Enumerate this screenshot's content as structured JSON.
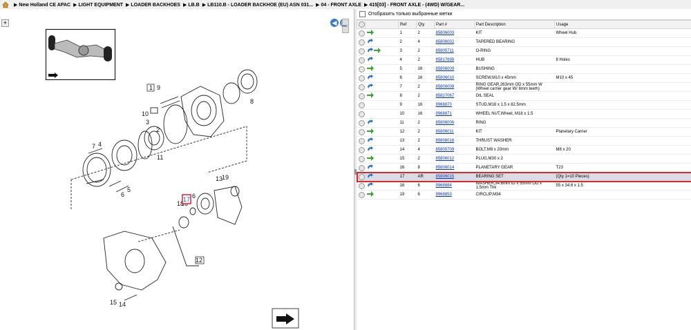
{
  "breadcrumb": {
    "items": [
      "New Holland CE APAC",
      "LIGHT EQUIPMENT",
      "LOADER BACKHOES",
      "LB.B",
      "LB110.B - LOADER BACKHOE (EU) ASN 031...",
      "04 - FRONT AXLE",
      "415[03] - FRONT AXLE - (4WD) W/GEAR..."
    ]
  },
  "filter": {
    "label": "Отобразить только выбранные метки"
  },
  "table": {
    "headers": [
      "Ref",
      "Qty",
      "Part #",
      "Part Description",
      "Usage"
    ],
    "rows": [
      {
        "ref": "1",
        "qty": "2",
        "part": "85806003",
        "desc": "KIT",
        "usage": "Wheel Hub",
        "icons": [
          "green"
        ]
      },
      {
        "ref": "2",
        "qty": "4",
        "part": "85806002",
        "desc": "TAPERED BEARING",
        "usage": "",
        "icons": [
          "blue"
        ]
      },
      {
        "ref": "3",
        "qty": "2",
        "part": "85805711",
        "desc": "O-RING",
        "usage": "",
        "icons": [
          "blue",
          "green"
        ]
      },
      {
        "ref": "4",
        "qty": "2",
        "part": "85817698",
        "desc": "HUB",
        "usage": "8 Holes",
        "icons": [
          "blue"
        ]
      },
      {
        "ref": "5",
        "qty": "16",
        "part": "85806009",
        "desc": "BUSHING",
        "usage": "",
        "icons": [
          "green"
        ]
      },
      {
        "ref": "6",
        "qty": "16",
        "part": "85806010",
        "desc": "SCREW,M10 x 45mm",
        "usage": "M10 x 45",
        "icons": [
          "blue"
        ]
      },
      {
        "ref": "7",
        "qty": "2",
        "part": "85806008",
        "desc": "RING GEAR,263mm OD x 55mm W (Wheel carrier gear W/ 8mm teeth)",
        "usage": "",
        "icons": [
          "blue"
        ]
      },
      {
        "ref": "8",
        "qty": "2",
        "part": "85827067",
        "desc": "OIL SEAL",
        "usage": "",
        "icons": [
          "green"
        ]
      },
      {
        "ref": "9",
        "qty": "16",
        "part": "9968870",
        "desc": "STUD,M18 x 1.5 x 82.5mm",
        "usage": "",
        "icons": []
      },
      {
        "ref": "10",
        "qty": "16",
        "part": "9968871",
        "desc": "WHEEL NUT,Wheel, M18 x 1.5",
        "usage": "",
        "icons": []
      },
      {
        "ref": "11",
        "qty": "2",
        "part": "85806006",
        "desc": "RING",
        "usage": "",
        "icons": [
          "blue"
        ]
      },
      {
        "ref": "12",
        "qty": "2",
        "part": "85806011",
        "desc": "KIT",
        "usage": "Planetary Carrier",
        "icons": [
          "green"
        ]
      },
      {
        "ref": "13",
        "qty": "2",
        "part": "85806016",
        "desc": "THRUST WASHER",
        "usage": "",
        "icons": [
          "blue"
        ]
      },
      {
        "ref": "14",
        "qty": "4",
        "part": "85805709",
        "desc": "BOLT,M8 x 20mm",
        "usage": "M8 x 20",
        "icons": [
          "blue"
        ]
      },
      {
        "ref": "15",
        "qty": "2",
        "part": "85806012",
        "desc": "PLUG,M30 x 2",
        "usage": "",
        "icons": [
          "green"
        ]
      },
      {
        "ref": "16",
        "qty": "8",
        "part": "85806014",
        "desc": "PLANETARY GEAR",
        "usage": "T23",
        "icons": [
          "blue"
        ]
      },
      {
        "ref": "17",
        "qty": "AR",
        "part": "85806015",
        "desc": "BEARING SET",
        "usage": "(Qty 1=10 Pieces)",
        "icons": [
          "blue"
        ],
        "selected": true
      },
      {
        "ref": "18",
        "qty": "6",
        "part": "9968884",
        "desc": "WASHER,34.6mm ID x 55mm OD x 1.5mm Thk",
        "usage": "55 x 34.6 x 1.5",
        "icons": [
          "blue"
        ]
      },
      {
        "ref": "19",
        "qty": "6",
        "part": "9968853",
        "desc": "CIRCLIP,M34",
        "usage": "",
        "icons": [
          "green"
        ]
      }
    ]
  },
  "diagram": {
    "callouts": [
      "1",
      "9",
      "10",
      "3",
      "2",
      "8",
      "7",
      "4",
      "11",
      "5",
      "6",
      "19",
      "13",
      "6",
      "18",
      "16",
      "12",
      "15",
      "14"
    ],
    "highlight": "17"
  },
  "colors": {
    "highlight": "#e0262b",
    "link": "#0033cc",
    "accent": "#3d7ccc",
    "selected_row": "#d7dde3"
  }
}
